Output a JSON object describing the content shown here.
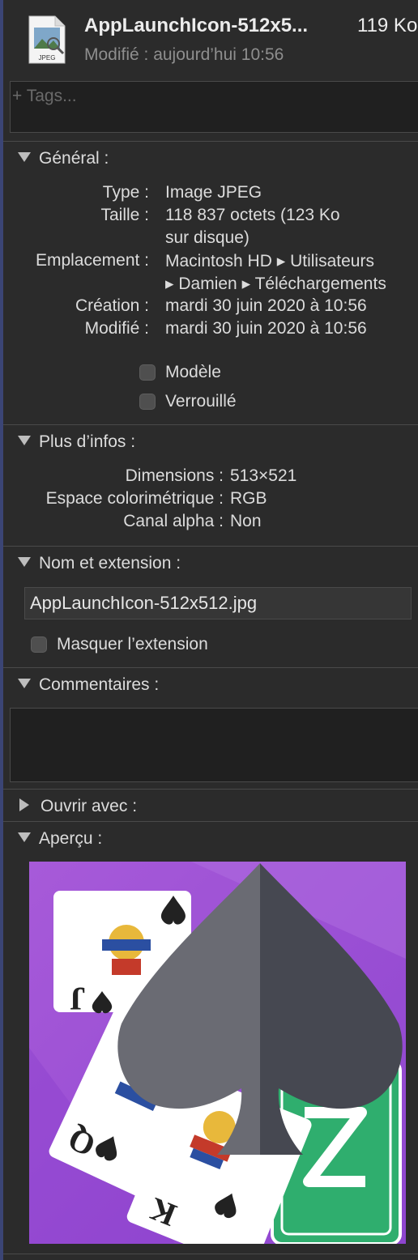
{
  "header": {
    "file_name": "AppLaunchIcon-512x5...",
    "file_size": "119 Ko",
    "modified": "Modifié : aujourd’hui 10:56",
    "file_icon_label": "JPEG"
  },
  "tags": {
    "placeholder": "+ Tags..."
  },
  "general": {
    "title": "Général :",
    "rows": [
      {
        "label": "Type :",
        "value": "Image JPEG"
      },
      {
        "label": "Taille :",
        "value": "118 837 octets (123 Ko",
        "value2": "sur disque)"
      },
      {
        "label": "Emplacement :",
        "value": "Macintosh HD ▸ Utilisateurs",
        "value2": "▸ Damien ▸ Téléchargements"
      },
      {
        "label": "Création :",
        "value": "mardi 30 juin 2020 à 10:56"
      },
      {
        "label": "Modifié :",
        "value": "mardi 30 juin 2020 à 10:56"
      }
    ],
    "checkboxes": [
      {
        "label": "Modèle",
        "checked": false
      },
      {
        "label": "Verrouillé",
        "checked": false
      }
    ]
  },
  "more_info": {
    "title": "Plus d’infos :",
    "rows": [
      {
        "label": "Dimensions :",
        "value": "513×521"
      },
      {
        "label": "Espace colorimétrique :",
        "value": "RGB"
      },
      {
        "label": "Canal alpha :",
        "value": "Non"
      }
    ]
  },
  "name_ext": {
    "title": "Nom et extension :",
    "value": "AppLaunchIcon-512x512.jpg",
    "hide_extension_label": "Masquer l’extension",
    "hide_extension_checked": false
  },
  "comments": {
    "title": "Commentaires :"
  },
  "open_with": {
    "title": "Ouvrir avec :"
  },
  "preview": {
    "title": "Aperçu :",
    "bg_color": "#9b4fd6",
    "spade_left_color": "#6a6b73",
    "spade_right_color": "#464851",
    "card_back_color": "#2fae6e"
  }
}
